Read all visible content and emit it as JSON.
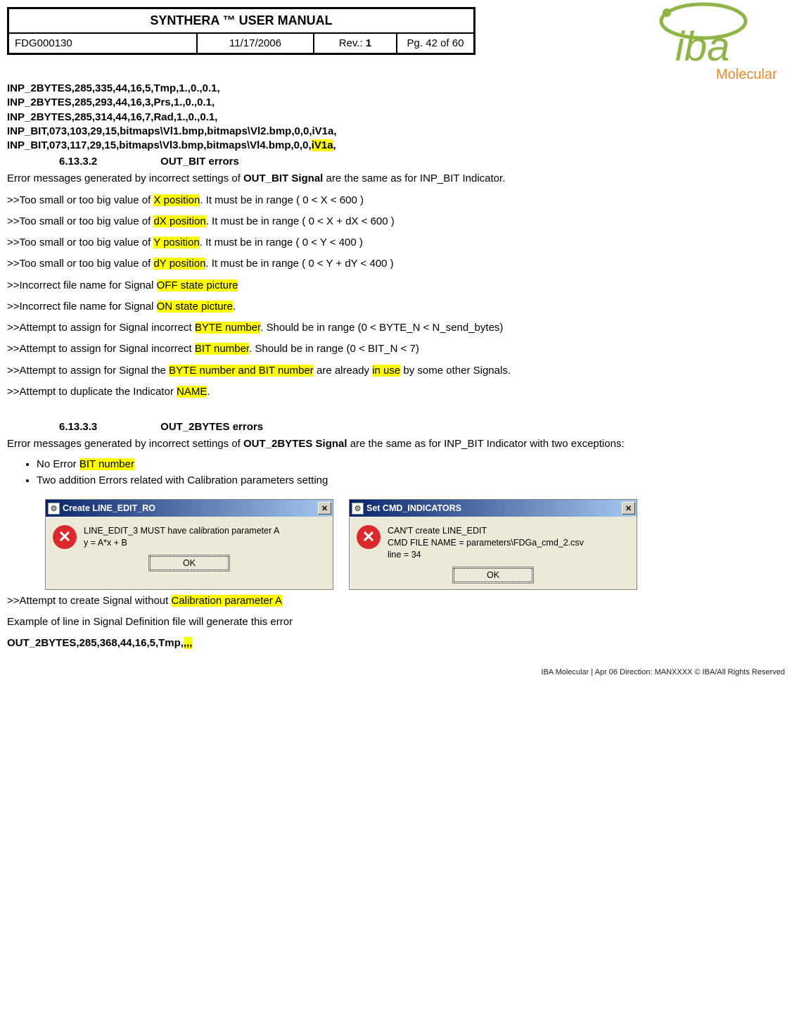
{
  "header": {
    "title": "SYNTHERA ™ USER MANUAL",
    "doc_no": "FDG000130",
    "date": "11/17/2006",
    "rev_label": "Rev.: ",
    "rev_value": "1",
    "page": "Pg. 42 of 60"
  },
  "logo": {
    "brand_top": "iba",
    "brand_sub": "Molecular"
  },
  "code_lines": {
    "l1": "INP_2BYTES,285,335,44,16,5,Tmp,1.,0.,0.1,",
    "l2": "INP_2BYTES,285,293,44,16,3,Prs,1.,0.,0.1,",
    "l3": "INP_2BYTES,285,314,44,16,7,Rad,1.,0.,0.1,",
    "l4": "INP_BIT,073,103,29,15,bitmaps\\Vl1.bmp,bitmaps\\Vl2.bmp,0,0,iV1a,",
    "l5_a": "INP_BIT,073,117,29,15,bitmaps\\Vl3.bmp,bitmaps\\Vl4.bmp,0,0,",
    "l5_hl": "iV1a",
    "l5_b": ","
  },
  "sec1": {
    "num": "6.13.3.2",
    "title": "OUT_BIT errors",
    "intro_a": "Error messages generated by incorrect settings of ",
    "intro_bold": "OUT_BIT Signal",
    "intro_b": " are the same as for INP_BIT Indicator."
  },
  "errors": {
    "e1": {
      "pre": ">>Too small or too big value of ",
      "hl": "X position",
      "post": ". It must be in range ( 0 < X < 600 )"
    },
    "e2": {
      "pre": ">>Too small or too big value of ",
      "hl": "dX position",
      "post": ". It must be in range ( 0 < X + dX < 600 )"
    },
    "e3": {
      "pre": ">>Too small or too big value of ",
      "hl": "Y position",
      "post": ". It must be in range ( 0 < Y < 400 )"
    },
    "e4": {
      "pre": ">>Too small or too big value of ",
      "hl": "dY position",
      "post": ". It must be in range ( 0 < Y + dY < 400 )"
    },
    "e5": {
      "pre": ">>Incorrect file name for Signal ",
      "hl": "OFF state picture",
      "post": ""
    },
    "e6": {
      "pre": ">>Incorrect file name for Signal ",
      "hl": "ON state picture",
      "post": "."
    },
    "e7": {
      "pre": ">>Attempt to assign for Signal incorrect ",
      "hl": "BYTE number",
      "post": ". Should be in range (0 < BYTE_N < N_send_bytes)"
    },
    "e8": {
      "pre": ">>Attempt to assign for Signal incorrect ",
      "hl": "BIT number",
      "post": ". Should be in range (0 < BIT_N < 7)"
    },
    "e9": {
      "pre": ">>Attempt to assign for Signal the ",
      "hl": "BYTE number and BIT number",
      "mid": " are already ",
      "hl2": "in use",
      "post": " by some other Signals."
    },
    "e10": {
      "pre": ">>Attempt to duplicate the Indicator ",
      "hl": "NAME",
      "post": "."
    }
  },
  "sec2": {
    "num": "6.13.3.3",
    "title": "OUT_2BYTES errors",
    "intro_a": "Error messages generated by incorrect settings of ",
    "intro_bold": "OUT_2BYTES Signal",
    "intro_b": " are the same as for INP_BIT Indicator with two exceptions:"
  },
  "bullets": {
    "b1_pre": "No Error ",
    "b1_hl": "BIT number",
    "b2": "Two addition Errors related with Calibration parameters setting"
  },
  "dlg1": {
    "title": "Create LINE_EDIT_RO",
    "text": "LINE_EDIT_3 MUST have calibration parameter A\ny = A*x + B",
    "ok": "OK"
  },
  "dlg2": {
    "title": "Set CMD_INDICATORS",
    "text": "CAN'T create LINE_EDIT\nCMD FILE NAME = parameters\\FDGa_cmd_2.csv\nline = 34",
    "ok": "OK"
  },
  "after": {
    "l1_pre": ">>Attempt to create Signal without ",
    "l1_hl": "Calibration parameter A",
    "l2": "Example of line in Signal Definition file will generate this error",
    "l3_pre": "OUT_2BYTES,285,368,44,16,5,Tmp,",
    "l3_hl": ",,,"
  },
  "footer": "IBA Molecular  |  Apr 06 Direction: MANXXXX © IBA/All Rights Reserved"
}
